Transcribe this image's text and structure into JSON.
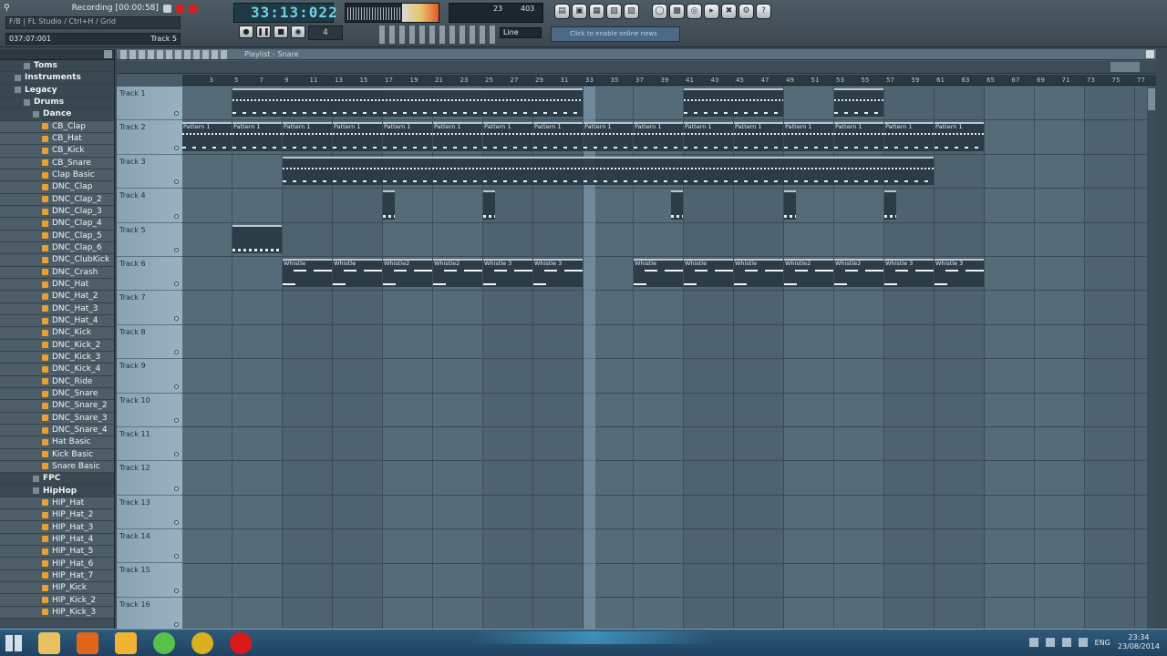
{
  "toolbar": {
    "recording_label": "Recording [00:00:58]",
    "hint_text": "F/B | FL Studio / Ctrl+H / Grid",
    "info_left": "037:07:001",
    "info_right": "Track 5",
    "song_time": "33:13:022",
    "pattern_num": "4",
    "snap": "Line",
    "cpu_value": "23",
    "mem_value": "403",
    "online_text": "Click to enable online news"
  },
  "browser": {
    "items": [
      {
        "label": "Toms",
        "type": "folder",
        "indent": 2
      },
      {
        "label": "Instruments",
        "type": "folder",
        "indent": 1
      },
      {
        "label": "Legacy",
        "type": "folder",
        "indent": 1
      },
      {
        "label": "Drums",
        "type": "folder",
        "indent": 2
      },
      {
        "label": "Dance",
        "type": "folder",
        "indent": 3
      },
      {
        "label": "CB_Clap",
        "type": "file",
        "indent": 4
      },
      {
        "label": "CB_Hat",
        "type": "file",
        "indent": 4
      },
      {
        "label": "CB_Kick",
        "type": "file",
        "indent": 4
      },
      {
        "label": "CB_Snare",
        "type": "file",
        "indent": 4
      },
      {
        "label": "Clap Basic",
        "type": "file",
        "indent": 4
      },
      {
        "label": "DNC_Clap",
        "type": "file",
        "indent": 4
      },
      {
        "label": "DNC_Clap_2",
        "type": "file",
        "indent": 4
      },
      {
        "label": "DNC_Clap_3",
        "type": "file",
        "indent": 4
      },
      {
        "label": "DNC_Clap_4",
        "type": "file",
        "indent": 4
      },
      {
        "label": "DNC_Clap_5",
        "type": "file",
        "indent": 4
      },
      {
        "label": "DNC_Clap_6",
        "type": "file",
        "indent": 4
      },
      {
        "label": "DNC_ClubKick",
        "type": "file",
        "indent": 4
      },
      {
        "label": "DNC_Crash",
        "type": "file",
        "indent": 4
      },
      {
        "label": "DNC_Hat",
        "type": "file",
        "indent": 4
      },
      {
        "label": "DNC_Hat_2",
        "type": "file",
        "indent": 4
      },
      {
        "label": "DNC_Hat_3",
        "type": "file",
        "indent": 4
      },
      {
        "label": "DNC_Hat_4",
        "type": "file",
        "indent": 4
      },
      {
        "label": "DNC_Kick",
        "type": "file",
        "indent": 4
      },
      {
        "label": "DNC_Kick_2",
        "type": "file",
        "indent": 4
      },
      {
        "label": "DNC_Kick_3",
        "type": "file",
        "indent": 4
      },
      {
        "label": "DNC_Kick_4",
        "type": "file",
        "indent": 4
      },
      {
        "label": "DNC_Ride",
        "type": "file",
        "indent": 4
      },
      {
        "label": "DNC_Snare",
        "type": "file",
        "indent": 4
      },
      {
        "label": "DNC_Snare_2",
        "type": "file",
        "indent": 4
      },
      {
        "label": "DNC_Snare_3",
        "type": "file",
        "indent": 4
      },
      {
        "label": "DNC_Snare_4",
        "type": "file",
        "indent": 4
      },
      {
        "label": "Hat Basic",
        "type": "file",
        "indent": 4
      },
      {
        "label": "Kick Basic",
        "type": "file",
        "indent": 4
      },
      {
        "label": "Snare Basic",
        "type": "file",
        "indent": 4
      },
      {
        "label": "FPC",
        "type": "folder",
        "indent": 3
      },
      {
        "label": "HipHop",
        "type": "folder",
        "indent": 3
      },
      {
        "label": "HIP_Hat",
        "type": "file",
        "indent": 4
      },
      {
        "label": "HIP_Hat_2",
        "type": "file",
        "indent": 4
      },
      {
        "label": "HIP_Hat_3",
        "type": "file",
        "indent": 4
      },
      {
        "label": "HIP_Hat_4",
        "type": "file",
        "indent": 4
      },
      {
        "label": "HIP_Hat_5",
        "type": "file",
        "indent": 4
      },
      {
        "label": "HIP_Hat_6",
        "type": "file",
        "indent": 4
      },
      {
        "label": "HIP_Hat_7",
        "type": "file",
        "indent": 4
      },
      {
        "label": "HIP_Kick",
        "type": "file",
        "indent": 4
      },
      {
        "label": "HIP_Kick_2",
        "type": "file",
        "indent": 4
      },
      {
        "label": "HIP_Kick_3",
        "type": "file",
        "indent": 4
      }
    ]
  },
  "playlist": {
    "title": "Playlist - Snare",
    "ruler_bars": [
      "3",
      "5",
      "7",
      "9",
      "11",
      "13",
      "15",
      "17",
      "19",
      "21",
      "23",
      "25",
      "27",
      "29",
      "31",
      "33",
      "35",
      "37",
      "39",
      "41",
      "43",
      "45",
      "47",
      "49",
      "51",
      "53",
      "55",
      "57",
      "59",
      "61",
      "63",
      "65",
      "67",
      "69",
      "71",
      "73",
      "75",
      "77"
    ],
    "playhead_bar": 33,
    "tracks": [
      "Track 1",
      "Track 2",
      "Track 3",
      "Track 4",
      "Track 5",
      "Track 6",
      "Track 7",
      "Track 8",
      "Track 9",
      "Track 10",
      "Track 11",
      "Track 12",
      "Track 13",
      "Track 14",
      "Track 15",
      "Track 16"
    ],
    "clips": [
      {
        "track": 0,
        "start": 5,
        "end": 33,
        "label": "",
        "kind": "dense"
      },
      {
        "track": 0,
        "start": 41,
        "end": 49,
        "label": "",
        "kind": "dense"
      },
      {
        "track": 0,
        "start": 53,
        "end": 57,
        "label": "",
        "kind": "dense"
      },
      {
        "track": 1,
        "start": 1,
        "end": 5,
        "label": "Pattern 1",
        "kind": "dense"
      },
      {
        "track": 1,
        "start": 5,
        "end": 9,
        "label": "Pattern 1",
        "kind": "dense"
      },
      {
        "track": 1,
        "start": 9,
        "end": 13,
        "label": "Pattern 1",
        "kind": "dense"
      },
      {
        "track": 1,
        "start": 13,
        "end": 17,
        "label": "Pattern 1",
        "kind": "dense"
      },
      {
        "track": 1,
        "start": 17,
        "end": 21,
        "label": "Pattern 1",
        "kind": "dense"
      },
      {
        "track": 1,
        "start": 21,
        "end": 25,
        "label": "Pattern 1",
        "kind": "dense"
      },
      {
        "track": 1,
        "start": 25,
        "end": 29,
        "label": "Pattern 1",
        "kind": "dense"
      },
      {
        "track": 1,
        "start": 29,
        "end": 33,
        "label": "Pattern 1",
        "kind": "dense"
      },
      {
        "track": 1,
        "start": 33,
        "end": 37,
        "label": "Pattern 1",
        "kind": "dense"
      },
      {
        "track": 1,
        "start": 37,
        "end": 41,
        "label": "Pattern 1",
        "kind": "dense"
      },
      {
        "track": 1,
        "start": 41,
        "end": 45,
        "label": "Pattern 1",
        "kind": "dense"
      },
      {
        "track": 1,
        "start": 45,
        "end": 49,
        "label": "Pattern 1",
        "kind": "dense"
      },
      {
        "track": 1,
        "start": 49,
        "end": 53,
        "label": "Pattern 1",
        "kind": "dense"
      },
      {
        "track": 1,
        "start": 53,
        "end": 57,
        "label": "Pattern 1",
        "kind": "dense"
      },
      {
        "track": 1,
        "start": 57,
        "end": 61,
        "label": "Pattern 1",
        "kind": "dense"
      },
      {
        "track": 1,
        "start": 61,
        "end": 65,
        "label": "Pattern 1",
        "kind": "dense"
      },
      {
        "track": 2,
        "start": 9,
        "end": 61,
        "label": "",
        "kind": "dense"
      },
      {
        "track": 3,
        "start": 17,
        "end": 18,
        "label": "",
        "kind": "plain"
      },
      {
        "track": 3,
        "start": 25,
        "end": 26,
        "label": "",
        "kind": "plain"
      },
      {
        "track": 3,
        "start": 40,
        "end": 41,
        "label": "",
        "kind": "plain"
      },
      {
        "track": 3,
        "start": 49,
        "end": 50,
        "label": "",
        "kind": "plain"
      },
      {
        "track": 3,
        "start": 57,
        "end": 58,
        "label": "",
        "kind": "plain"
      },
      {
        "track": 4,
        "start": 5,
        "end": 9,
        "label": "",
        "kind": "plain"
      },
      {
        "track": 5,
        "start": 9,
        "end": 13,
        "label": "Whistle",
        "kind": "whistle"
      },
      {
        "track": 5,
        "start": 13,
        "end": 17,
        "label": "Whistle",
        "kind": "whistle"
      },
      {
        "track": 5,
        "start": 17,
        "end": 21,
        "label": "Whistle2",
        "kind": "whistle"
      },
      {
        "track": 5,
        "start": 21,
        "end": 25,
        "label": "Whistle2",
        "kind": "whistle"
      },
      {
        "track": 5,
        "start": 25,
        "end": 29,
        "label": "Whistle 3",
        "kind": "whistle"
      },
      {
        "track": 5,
        "start": 29,
        "end": 33,
        "label": "Whistle 3",
        "kind": "whistle"
      },
      {
        "track": 5,
        "start": 37,
        "end": 41,
        "label": "Whistle",
        "kind": "whistle"
      },
      {
        "track": 5,
        "start": 41,
        "end": 45,
        "label": "Whistle",
        "kind": "whistle"
      },
      {
        "track": 5,
        "start": 45,
        "end": 49,
        "label": "Whistle",
        "kind": "whistle"
      },
      {
        "track": 5,
        "start": 49,
        "end": 53,
        "label": "Whistle2",
        "kind": "whistle"
      },
      {
        "track": 5,
        "start": 53,
        "end": 57,
        "label": "Whistle2",
        "kind": "whistle"
      },
      {
        "track": 5,
        "start": 57,
        "end": 61,
        "label": "Whistle 3",
        "kind": "whistle"
      },
      {
        "track": 5,
        "start": 61,
        "end": 65,
        "label": "Whistle 3",
        "kind": "whistle"
      }
    ]
  },
  "taskbar": {
    "apps": [
      {
        "name": "file-explorer-icon",
        "color": "#e8c060"
      },
      {
        "name": "firefox-icon",
        "color": "#e0661c"
      },
      {
        "name": "fl-studio-icon",
        "color": "#f2b233"
      },
      {
        "name": "spotify-icon",
        "color": "#57c24a"
      },
      {
        "name": "chrome-icon",
        "color": "#d9b020"
      },
      {
        "name": "record-icon",
        "color": "#d91a1a"
      }
    ],
    "lang": "ENG",
    "time": "23:34",
    "date": "23/08/2014"
  }
}
